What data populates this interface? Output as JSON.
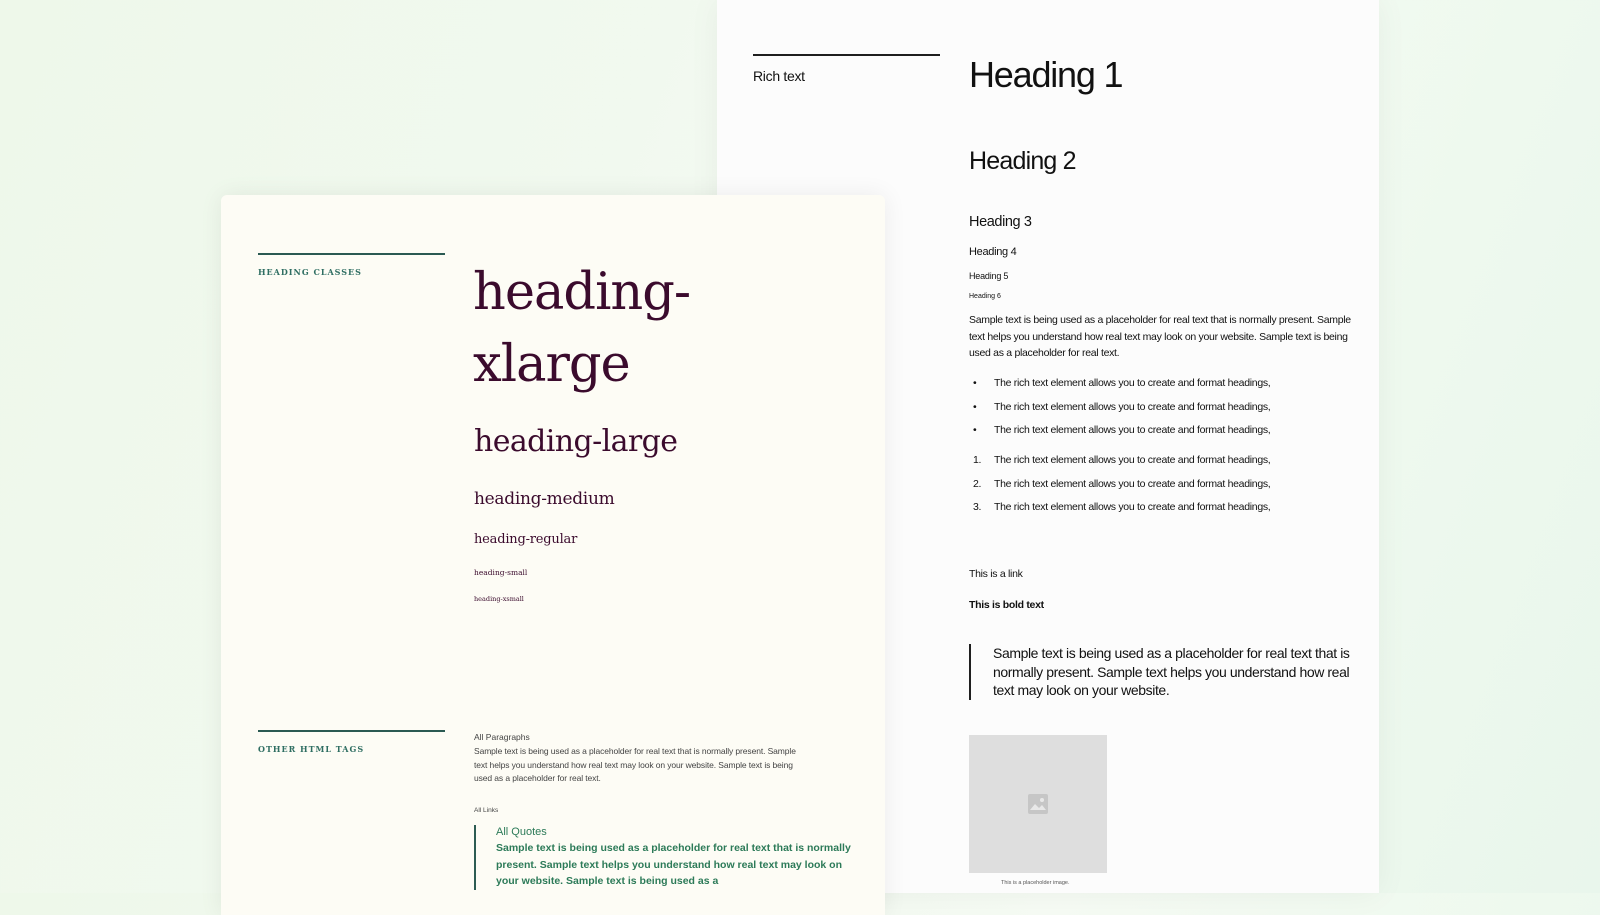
{
  "rich_text_card": {
    "label": "Rich text",
    "heading1": "Heading 1",
    "heading2": "Heading 2",
    "heading3": "Heading 3",
    "heading4": "Heading 4",
    "heading5": "Heading 5",
    "heading6": "Heading 6",
    "paragraph": "Sample text is being used as a placeholder for real text that is normally present. Sample text helps you understand how real text may look on your website. Sample text is being used as a placeholder for real text.",
    "bullet_items": [
      "The rich text element allows you to create and format headings,",
      "The rich text element allows you to create and format headings,",
      "The rich text element allows you to create and format headings,"
    ],
    "numbered_items": [
      {
        "marker": "1.",
        "text": "The rich text element allows you to create and format headings,"
      },
      {
        "marker": "2.",
        "text": "The rich text element allows you to create and format headings,"
      },
      {
        "marker": "3.",
        "text": "The rich text element allows you to create and format headings,"
      }
    ],
    "link_text": "This is a link",
    "bold_text": "This is bold text",
    "blockquote": "Sample text is being used as a placeholder for real text that is normally present. Sample text helps you understand how real text may look on your website.",
    "image_icon": "image-placeholder-icon",
    "image_caption": "This is a placeholder image."
  },
  "heading_classes_card": {
    "section1_label": "HEADING CLASSES",
    "xlarge": "heading-xlarge",
    "large": "heading-large",
    "medium": "heading-medium",
    "regular": "heading-regular",
    "small": "heading-small",
    "xsmall": "heading-xsmall",
    "section2_label": "OTHER HTML TAGS",
    "paragraphs_label": "All Paragraphs",
    "paragraph": "Sample text is being used as a placeholder for real text that is normally present. Sample text helps you understand how real text may look on your website. Sample text is being used as a placeholder for real text.",
    "links_label": "All Links",
    "quotes_label": "All Quotes",
    "quote_text": "Sample text is being used as a placeholder for real text that is normally present. Sample text helps you understand how real text may look on your website. Sample text is being used as a"
  },
  "colors": {
    "heading_class_text": "#3b0b2d",
    "section_label": "#2f6e62",
    "quote_accent": "#2c7a58",
    "front_card_bg": "#fdfcf5",
    "back_card_bg": "#fcfcfc"
  }
}
